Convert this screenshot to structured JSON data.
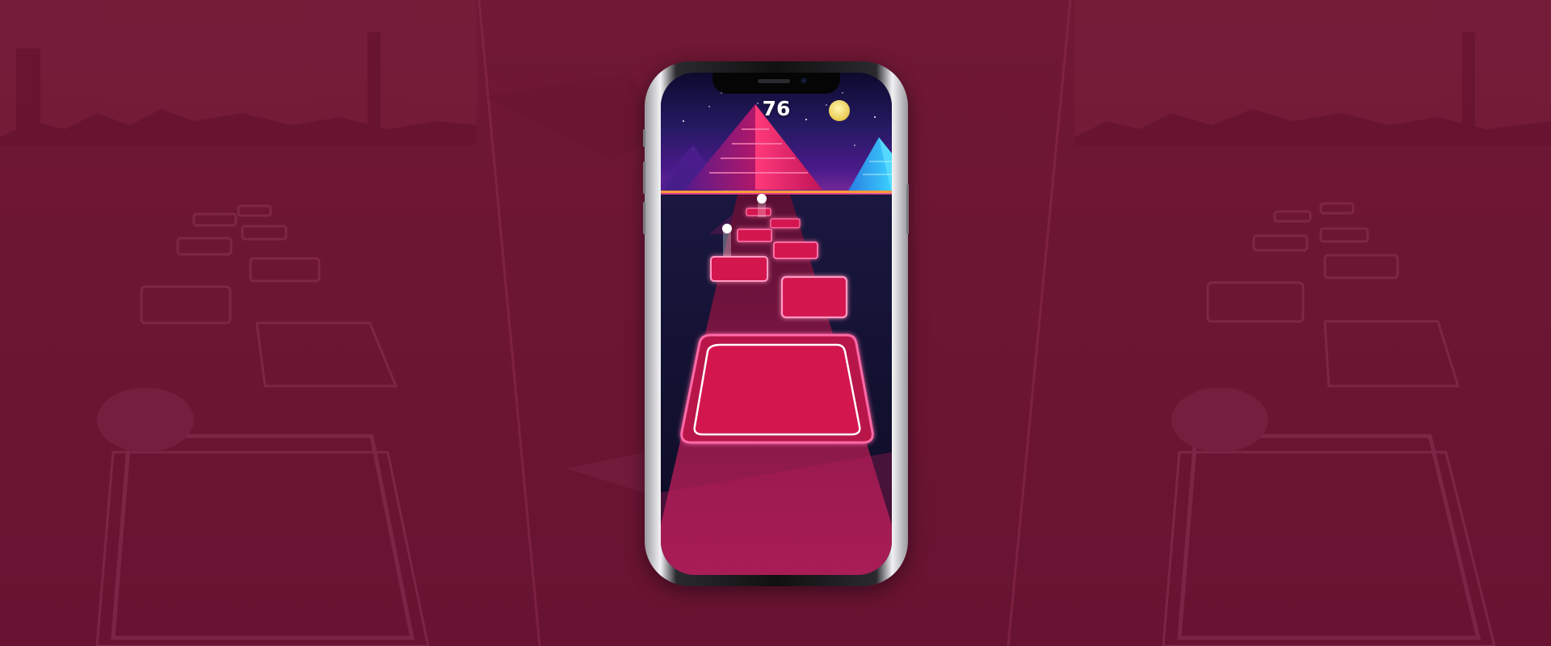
{
  "game": {
    "score": "76"
  },
  "colors": {
    "background": "#6b1533",
    "tile": "#d4124f",
    "tile_glow": "#ff5a9a",
    "road": "#8c1b48",
    "sky_top": "#0d0a2e",
    "sky_horizon": "#4a1a8a",
    "moon": "#f7e27a"
  },
  "scene": {
    "theme": "neon pyramids at night",
    "icons": [
      "moon-icon",
      "ball-icon",
      "pyramid-icon"
    ]
  }
}
